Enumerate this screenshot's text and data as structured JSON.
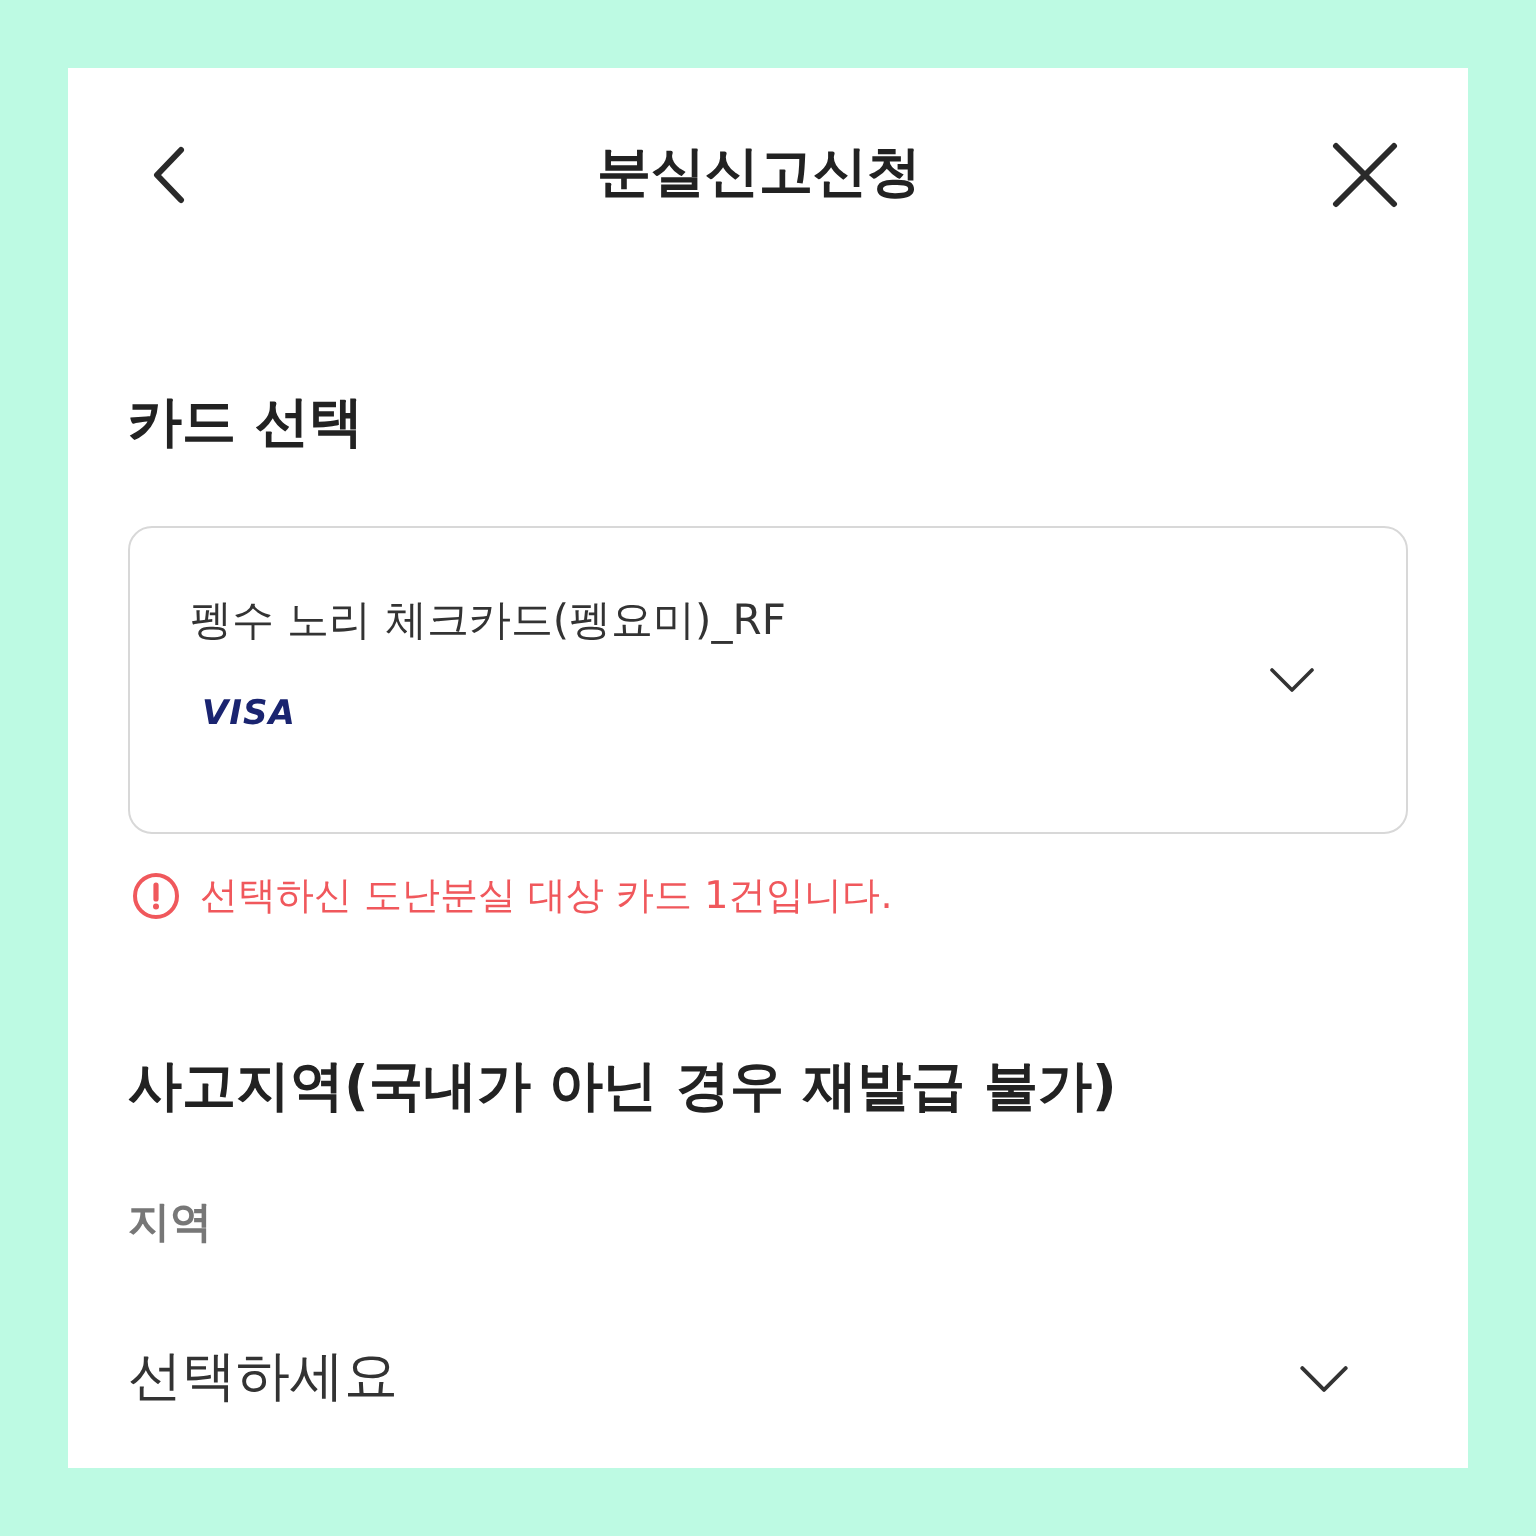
{
  "header": {
    "title": "분실신고신청"
  },
  "card_section": {
    "heading": "카드 선택",
    "selected_card": {
      "name": "펭수 노리 체크카드(펭요미)_RF",
      "brand": "VISA"
    },
    "notice": "선택하신 도난분실 대상 카드 1건입니다."
  },
  "region_section": {
    "heading": "사고지역(국내가 아닌 경우 재발급 불가)",
    "field_label": "지역",
    "placeholder": "선택하세요"
  }
}
